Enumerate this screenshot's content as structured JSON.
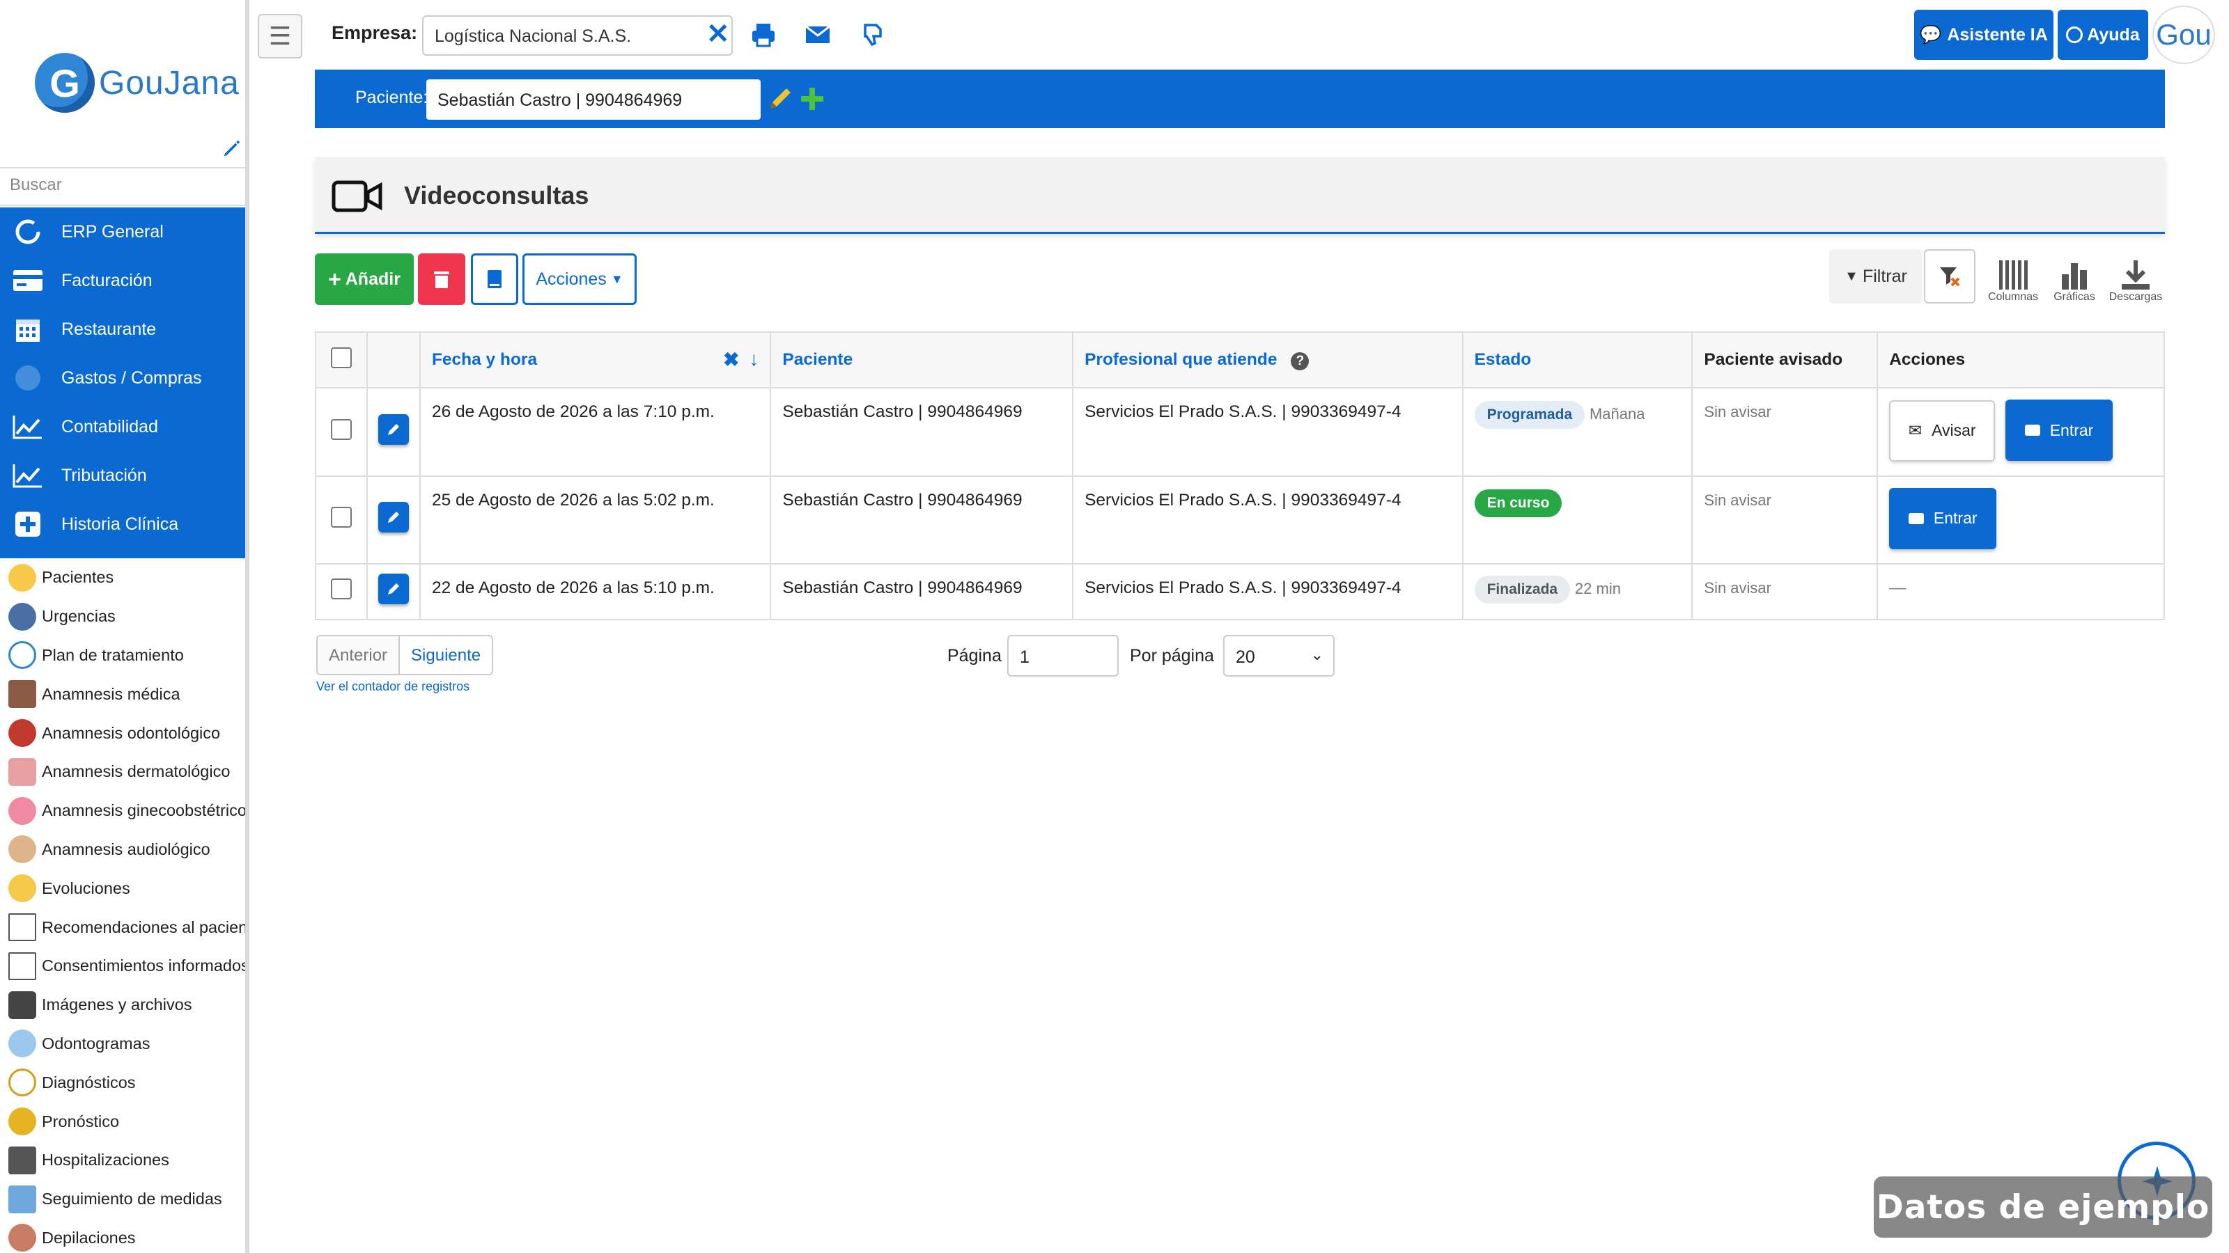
{
  "sidebar": {
    "logo_text": "GouJana",
    "search_placeholder": "Buscar",
    "modules": [
      "ERP General",
      "Facturación",
      "Restaurante",
      "Gastos / Compras",
      "Contabilidad",
      "Tributación",
      "Historia Clínica"
    ],
    "clinical_items": [
      "Pacientes",
      "Urgencias",
      "Plan de tratamiento",
      "Anamnesis médica",
      "Anamnesis odontológico",
      "Anamnesis dermatológico",
      "Anamnesis ginecoobstétrico",
      "Anamnesis audiológico",
      "Evoluciones",
      "Recomendaciones al paciente",
      "Consentimientos informados",
      "Imágenes y archivos",
      "Odontogramas",
      "Diagnósticos",
      "Pronóstico",
      "Hospitalizaciones",
      "Seguimiento de medidas",
      "Depilaciones"
    ]
  },
  "topbar": {
    "empresa_label": "Empresa:",
    "empresa_value": "Logística Nacional S.A.S.",
    "ia_button": "Asistente IA",
    "help_button": "Ayuda",
    "avatar_text": "Gou"
  },
  "patient": {
    "label": "Paciente:",
    "value": "Sebastián Castro | 9904864969"
  },
  "page": {
    "title": "Videoconsultas"
  },
  "toolbar": {
    "add_label": "Añadir",
    "actions_label": "Acciones",
    "filter_label": "Filtrar",
    "columns_label": "Columnas",
    "charts_label": "Gráficas",
    "downloads_label": "Descargas"
  },
  "table": {
    "headers": {
      "date": "Fecha y hora",
      "patient": "Paciente",
      "professional": "Profesional que atiende",
      "status": "Estado",
      "notified": "Paciente avisado",
      "actions": "Acciones"
    },
    "rows": [
      {
        "date": "26 de Agosto de 2026 a las 7:10 p.m.",
        "patient": "Sebastián Castro | 9904864969",
        "professional": "Servicios El Prado S.A.S. | 9903369497-4",
        "status": "Programada",
        "status_note": "Mañana",
        "notified": "Sin avisar",
        "notify_btn": "Avisar",
        "enter_btn": "Entrar"
      },
      {
        "date": "25 de Agosto de 2026 a las 5:02 p.m.",
        "patient": "Sebastián Castro | 9904864969",
        "professional": "Servicios El Prado S.A.S. | 9903369497-4",
        "status": "En curso",
        "status_note": "",
        "notified": "Sin avisar",
        "enter_btn": "Entrar"
      },
      {
        "date": "22 de Agosto de 2026 a las 5:10 p.m.",
        "patient": "Sebastián Castro | 9904864969",
        "professional": "Servicios El Prado S.A.S. | 9903369497-4",
        "status": "Finalizada",
        "status_note": "22 min",
        "notified": "Sin avisar",
        "actions_empty": "—"
      }
    ]
  },
  "pagination": {
    "prev": "Anterior",
    "next": "Siguiente",
    "counter_link": "Ver el contador de registros",
    "page_label": "Página",
    "page_value": "1",
    "per_page_label": "Por página",
    "per_page_value": "20"
  },
  "watermark": "Datos de ejemplo",
  "colors": {
    "primary": "#0a6ad1",
    "success": "#28a745",
    "danger": "#f0354f"
  }
}
